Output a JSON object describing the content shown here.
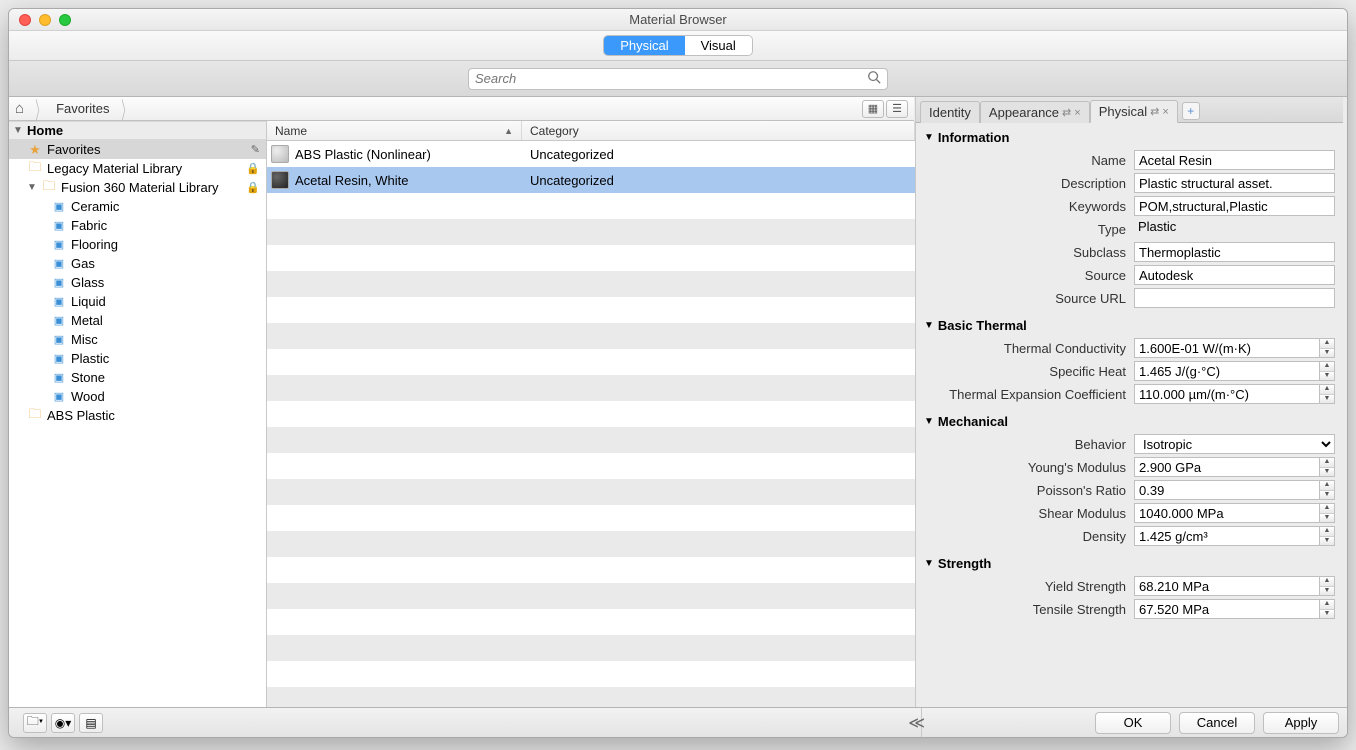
{
  "window": {
    "title": "Material Browser"
  },
  "modes": {
    "physical": "Physical",
    "visual": "Visual",
    "active": "physical"
  },
  "search": {
    "placeholder": "Search"
  },
  "breadcrumb": {
    "root": "Favorites"
  },
  "tree": {
    "home": "Home",
    "favorites": "Favorites",
    "legacy": "Legacy Material Library",
    "fusion360": "Fusion 360 Material Library",
    "categories": [
      "Ceramic",
      "Fabric",
      "Flooring",
      "Gas",
      "Glass",
      "Liquid",
      "Metal",
      "Misc",
      "Plastic",
      "Stone",
      "Wood"
    ],
    "abs_folder": "ABS Plastic"
  },
  "table": {
    "col_name": "Name",
    "col_category": "Category",
    "rows": [
      {
        "name": "ABS Plastic (Nonlinear)",
        "category": "Uncategorized",
        "selected": false,
        "swatch": "abs"
      },
      {
        "name": "Acetal Resin, White",
        "category": "Uncategorized",
        "selected": true,
        "swatch": "acetal"
      }
    ]
  },
  "tabs": {
    "identity": "Identity",
    "appearance": "Appearance",
    "physical": "Physical"
  },
  "props": {
    "information": {
      "header": "Information",
      "name_label": "Name",
      "name": "Acetal Resin",
      "description_label": "Description",
      "description": "Plastic structural asset.",
      "keywords_label": "Keywords",
      "keywords": "POM,structural,Plastic",
      "type_label": "Type",
      "type": "Plastic",
      "subclass_label": "Subclass",
      "subclass": "Thermoplastic",
      "source_label": "Source",
      "source": "Autodesk",
      "sourceurl_label": "Source URL",
      "sourceurl": ""
    },
    "thermal": {
      "header": "Basic Thermal",
      "conductivity_label": "Thermal Conductivity",
      "conductivity": "1.600E-01 W/(m·K)",
      "specificheat_label": "Specific Heat",
      "specificheat": "1.465 J/(g·°C)",
      "expansion_label": "Thermal Expansion Coefficient",
      "expansion": "110.000 µm/(m·°C)"
    },
    "mechanical": {
      "header": "Mechanical",
      "behavior_label": "Behavior",
      "behavior": "Isotropic",
      "youngs_label": "Young's Modulus",
      "youngs": "2.900 GPa",
      "poisson_label": "Poisson's Ratio",
      "poisson": "0.39",
      "shear_label": "Shear Modulus",
      "shear": "1040.000 MPa",
      "density_label": "Density",
      "density": "1.425 g/cm³"
    },
    "strength": {
      "header": "Strength",
      "yield_label": "Yield Strength",
      "yield": "68.210 MPa",
      "tensile_label": "Tensile Strength",
      "tensile": "67.520 MPa"
    }
  },
  "buttons": {
    "ok": "OK",
    "cancel": "Cancel",
    "apply": "Apply"
  }
}
